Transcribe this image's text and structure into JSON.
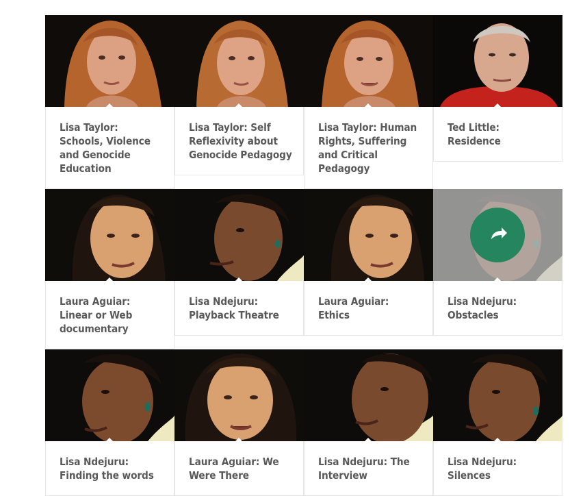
{
  "video_grid": {
    "rows": [
      [
        {
          "title": "Lisa Taylor: Schools, Violence and Genocide Education",
          "speaker": "lisa-taylor"
        },
        {
          "title": "Lisa Taylor: Self Reflexivity about Genocide Pedagogy",
          "speaker": "lisa-taylor"
        },
        {
          "title": "Lisa Taylor: Human Rights, Suffering and Critical Pedagogy",
          "speaker": "lisa-taylor"
        },
        {
          "title": "Ted Little: Residence",
          "speaker": "ted-little"
        }
      ],
      [
        {
          "title": "Laura Aguiar: Linear or Web documentary",
          "speaker": "laura-aguiar"
        },
        {
          "title": "Lisa Ndejuru: Playback Theatre",
          "speaker": "lisa-ndejuru"
        },
        {
          "title": "Laura Aguiar: Ethics",
          "speaker": "laura-aguiar"
        },
        {
          "title": "Lisa Ndejuru: Obstacles",
          "speaker": "lisa-ndejuru",
          "hovered": true
        }
      ],
      [
        {
          "title": "Lisa Ndejuru: Finding the words",
          "speaker": "lisa-ndejuru"
        },
        {
          "title": "Laura Aguiar: We Were There",
          "speaker": "laura-aguiar"
        },
        {
          "title": "Lisa Ndejuru: The Interview",
          "speaker": "lisa-ndejuru"
        },
        {
          "title": "Lisa Ndejuru: Silences",
          "speaker": "lisa-ndejuru"
        }
      ]
    ]
  },
  "share_icon": "share-arrow-icon",
  "colors": {
    "caption_text": "#595959",
    "share_button": "#24855f",
    "thumb_background": "#0c0a08"
  }
}
